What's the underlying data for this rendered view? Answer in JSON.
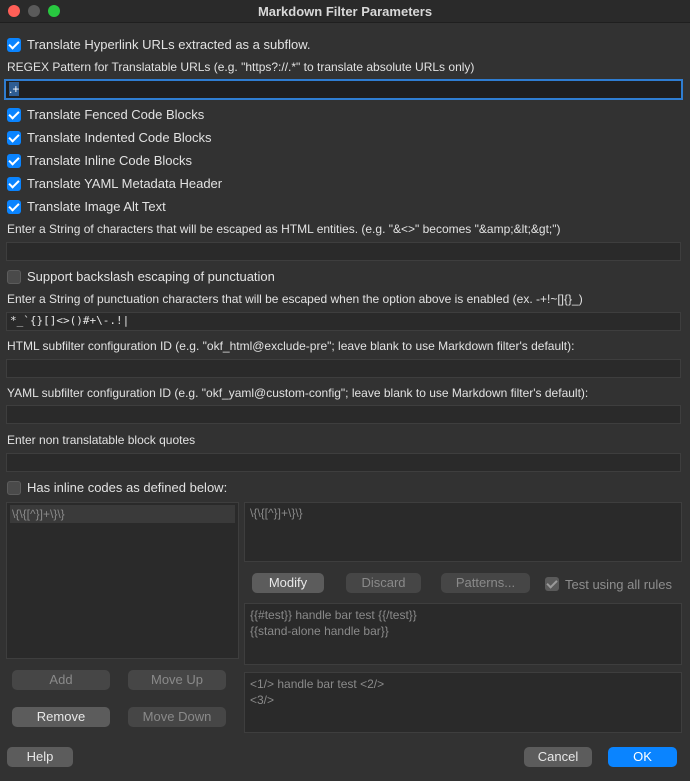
{
  "window": {
    "title": "Markdown Filter Parameters"
  },
  "options": {
    "translate_hyperlinks": "Translate Hyperlink URLs extracted as a subflow.",
    "regex_label": "REGEX Pattern for Translatable URLs (e.g. \"https?://.*\" to translate absolute URLs only)",
    "regex_value": ".+",
    "fenced": "Translate Fenced Code Blocks",
    "indented": "Translate Indented Code Blocks",
    "inline": "Translate Inline Code Blocks",
    "yaml_header": "Translate YAML Metadata Header",
    "alt_text": "Translate Image Alt Text",
    "html_entities_label": "Enter a String of characters that will be escaped as  HTML entities. (e.g. \"&<>\" becomes \"&amp;&lt;&gt;\")",
    "html_entities_value": "",
    "backslash": "Support backslash escaping of punctuation",
    "punct_label": "Enter a String of punctuation characters that will be escaped when the option above is enabled (ex. -+!~[]{}_)",
    "punct_value": "*_`{}[]<>()#+\\-.!|",
    "html_subfilter_label": "HTML subfilter configuration ID (e.g. \"okf_html@exclude-pre\"; leave blank to use Markdown filter's default):",
    "html_subfilter_value": "",
    "yaml_subfilter_label": "YAML subfilter configuration ID (e.g. \"okf_yaml@custom-config\"; leave blank to use Markdown filter's default):",
    "yaml_subfilter_value": "",
    "non_translatable_label": "Enter non translatable block quotes",
    "non_translatable_value": "",
    "inline_codes": "Has inline codes as defined below:"
  },
  "inline_codes": {
    "rules_list": [
      "\\{\\{[^}]+\\}\\}"
    ],
    "rule_editor": "\\{\\{[^}]+\\}\\}",
    "buttons": {
      "modify": "Modify",
      "discard": "Discard",
      "patterns": "Patterns...",
      "add": "Add",
      "move_up": "Move Up",
      "remove": "Remove",
      "move_down": "Move Down"
    },
    "test_all_rules": "Test using all rules",
    "test_input": "{{#test}} handle bar test {{/test}}\n{{stand-alone handle bar}}",
    "test_output": "<1/> handle bar test <2/>\n<3/>"
  },
  "footer": {
    "help": "Help",
    "cancel": "Cancel",
    "ok": "OK"
  }
}
